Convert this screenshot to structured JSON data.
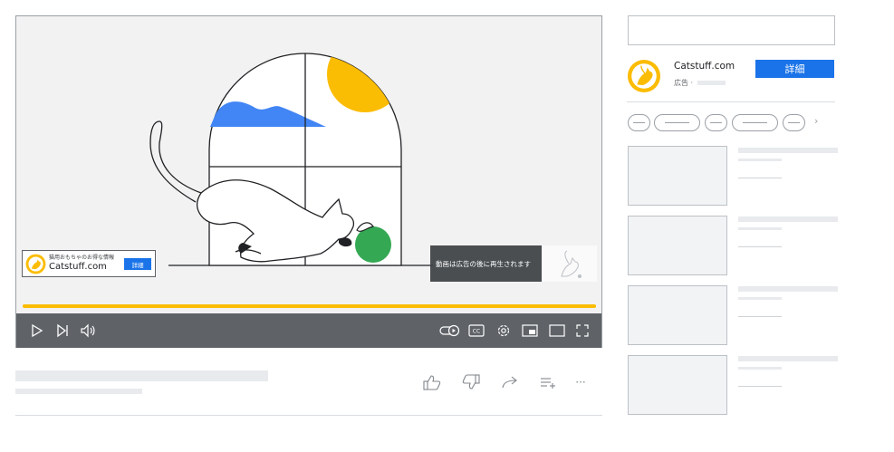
{
  "player": {
    "progress_fraction": 1.0,
    "accent_color": "#fbbc04",
    "overlay_ad": {
      "tagline": "猫用おもちゃのお得な情報",
      "domain": "Catstuff.com",
      "button_label": "詳細"
    },
    "skip_notice": "動画は広告の後に再生されます",
    "controls": {
      "left_icons": [
        "play-icon",
        "next-icon",
        "volume-icon"
      ],
      "right_icons": [
        "autoplay-icon",
        "captions-icon",
        "settings-icon",
        "miniplayer-icon",
        "theater-icon",
        "fullscreen-icon"
      ],
      "captions_label": "CC"
    }
  },
  "actions": {
    "icons": [
      "like-icon",
      "dislike-icon",
      "share-icon",
      "save-to-playlist-icon",
      "more-icon"
    ],
    "more_label": "···"
  },
  "sidebar": {
    "ad": {
      "title": "Catstuff.com",
      "label": "広告 ·",
      "button_label": "詳細",
      "brand_color": "#fbbc04",
      "button_color": "#1a73e8"
    },
    "chips_next_label": "›",
    "suggestions": [
      {},
      {},
      {},
      {}
    ]
  }
}
